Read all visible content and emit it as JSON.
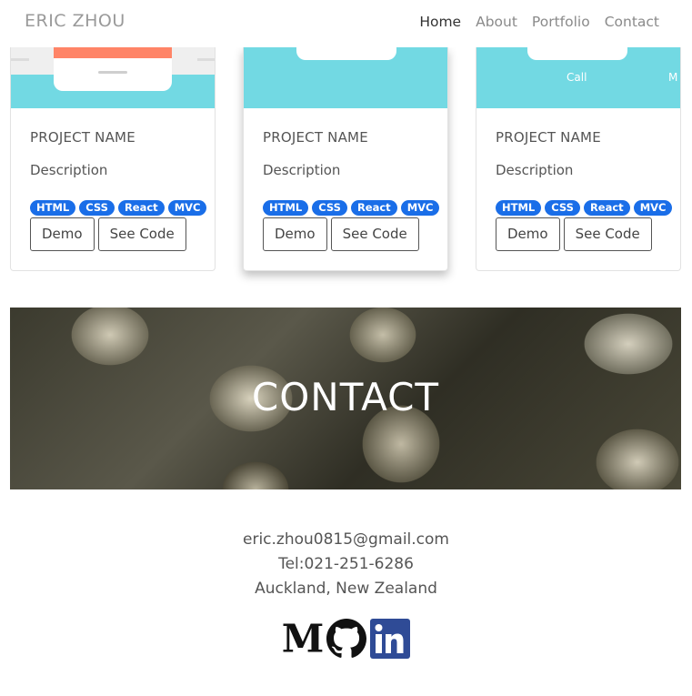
{
  "navbar": {
    "brand": "ERIC ZHOU",
    "links": [
      {
        "label": "Home",
        "active": true
      },
      {
        "label": "About",
        "active": false
      },
      {
        "label": "Portfolio",
        "active": false
      },
      {
        "label": "Contact",
        "active": false
      }
    ]
  },
  "projects": [
    {
      "title": "PROJECT NAME",
      "description": "Description",
      "tags": [
        "HTML",
        "CSS",
        "React",
        "MVC"
      ],
      "demo_label": "Demo",
      "code_label": "See Code"
    },
    {
      "title": "PROJECT NAME",
      "description": "Description",
      "tags": [
        "HTML",
        "CSS",
        "React",
        "MVC"
      ],
      "demo_label": "Demo",
      "code_label": "See Code"
    },
    {
      "title": "PROJECT NAME",
      "description": "Description",
      "tags": [
        "HTML",
        "CSS",
        "React",
        "MVC"
      ],
      "demo_label": "Demo",
      "code_label": "See Code",
      "image_caption": "Call"
    }
  ],
  "contact": {
    "banner_title": "CONTACT",
    "email": "eric.zhou0815@gmail.com",
    "phone": "Tel:021-251-6286",
    "location": "Auckland, New Zealand",
    "socials": [
      "medium-icon",
      "github-icon",
      "linkedin-icon"
    ]
  },
  "colors": {
    "tag_blue": "#1a6ee8",
    "teal": "#72d9e3",
    "linkedin": "#2f4b96"
  }
}
